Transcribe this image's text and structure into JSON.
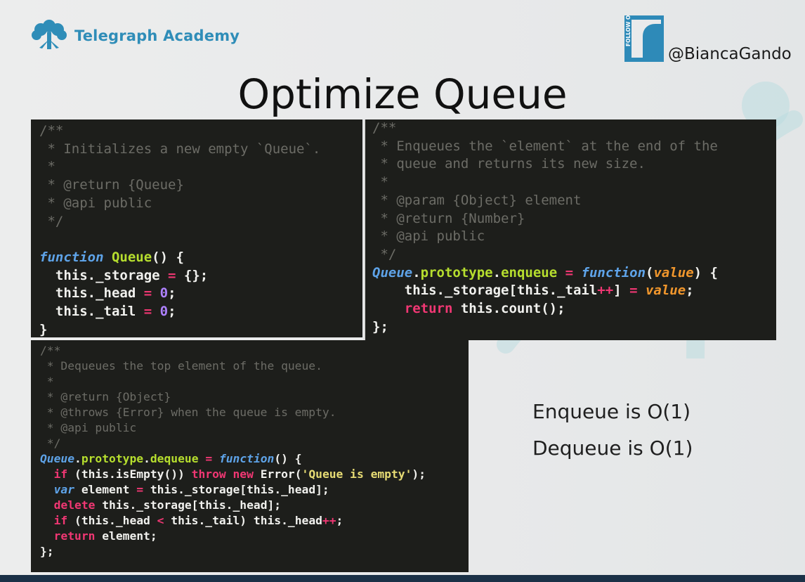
{
  "brand": {
    "name": "Telegraph Academy",
    "color": "#2f8db8"
  },
  "social": {
    "follow_badge": "FOLLOW ON",
    "handle": "@BiancaGando"
  },
  "slide_title": "Optimize Queue",
  "code_blocks": {
    "constructor": [
      "/**",
      " * Initializes a new empty `Queue`.",
      " *",
      " * @return {Queue}",
      " * @api public",
      " */",
      "",
      "function Queue() {",
      "  this._storage = {};",
      "  this._head = 0;",
      "  this._tail = 0;",
      "}"
    ],
    "enqueue": [
      "/**",
      " * Enqueues the `element` at the end of the",
      " * queue and returns its new size.",
      " *",
      " * @param {Object} element",
      " * @return {Number}",
      " * @api public",
      " */",
      "Queue.prototype.enqueue = function(value) {",
      "    this._storage[this._tail++] = value;",
      "    return this.count();",
      "};"
    ],
    "dequeue": [
      "/**",
      " * Dequeues the top element of the queue.",
      " *",
      " * @return {Object}",
      " * @throws {Error} when the queue is empty.",
      " * @api public",
      " */",
      "Queue.prototype.dequeue = function() {",
      "  if (this.isEmpty()) throw new Error('Queue is empty');",
      "  var element = this._storage[this._head];",
      "  delete this._storage[this._head];",
      "  if (this._head < this._tail) this._head++;",
      "  return element;",
      "};"
    ]
  },
  "notes": {
    "enqueue": "Enqueue is O(1)",
    "dequeue": "Dequeue is O(1)"
  },
  "colors": {
    "code_bg": "#1d1e1b",
    "keyword": "#5ea3e8",
    "function_name": "#b6de2e",
    "operator": "#f03773",
    "number": "#ae81ff",
    "string": "#e6db74",
    "param": "#f0962c",
    "comment": "#6c6c66"
  },
  "icons": {
    "logo": "tree-icon",
    "social": "twitter-follow-icon"
  }
}
